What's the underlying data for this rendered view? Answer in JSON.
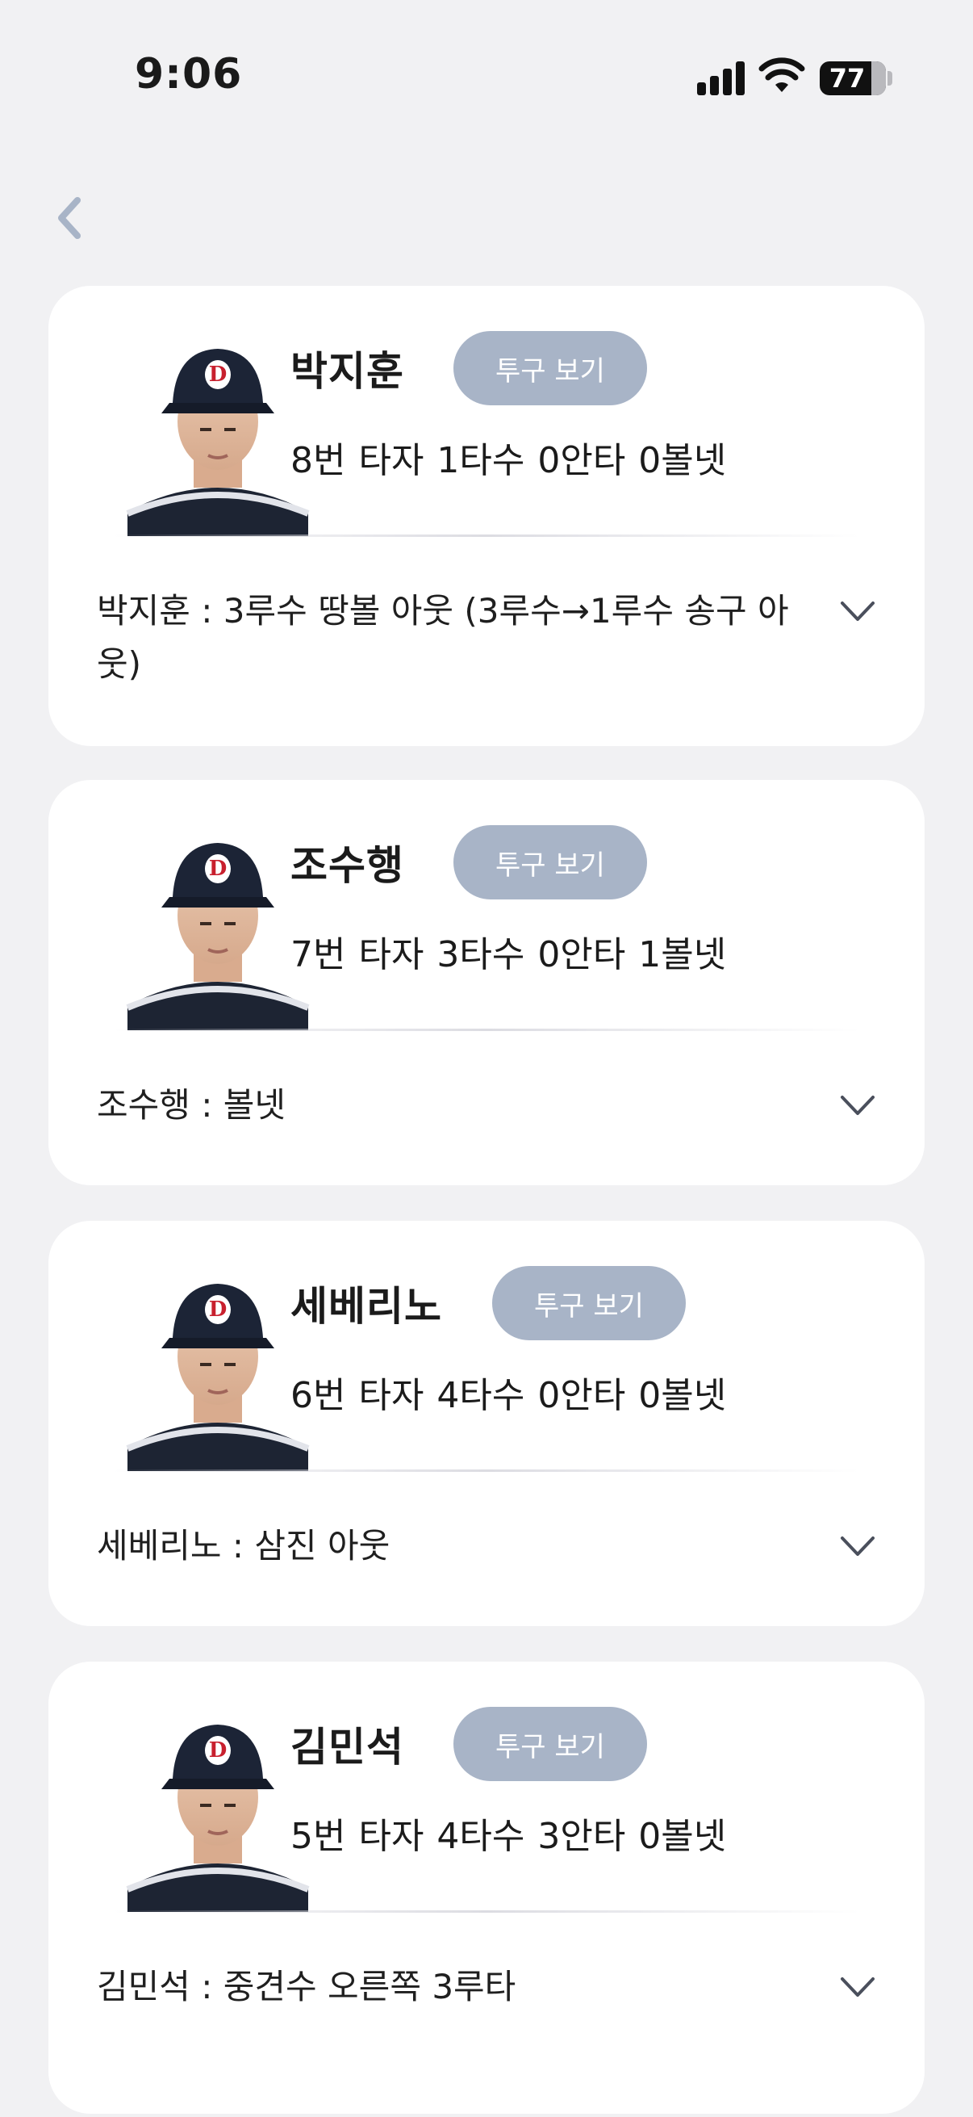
{
  "status_bar": {
    "time": "9:06",
    "battery": "77",
    "icons": [
      "signal-icon",
      "wifi-icon",
      "battery-icon"
    ]
  },
  "nav": {
    "back_icon": "chevron-left-icon"
  },
  "colors": {
    "background": "#f1f1f3",
    "card": "#ffffff",
    "button": "#a8b4c7",
    "back": "#a8b4c7"
  },
  "players": [
    {
      "name": "박지훈",
      "button": "투구 보기",
      "stats": "8번 타자  1타수 0안타 0볼넷",
      "play": "박지훈 : 3루수 땅볼 아웃 (3루수→1루수 송구 아웃)"
    },
    {
      "name": "조수행",
      "button": "투구 보기",
      "stats": "7번 타자  3타수 0안타 1볼넷",
      "play": "조수행 : 볼넷"
    },
    {
      "name": "세베리노",
      "button": "투구 보기",
      "stats": "6번 타자  4타수 0안타 0볼넷",
      "play": "세베리노 : 삼진 아웃"
    },
    {
      "name": "김민석",
      "button": "투구 보기",
      "stats": "5번 타자  4타수 3안타 0볼넷",
      "play": "김민석 : 중견수 오른쪽 3루타"
    }
  ]
}
